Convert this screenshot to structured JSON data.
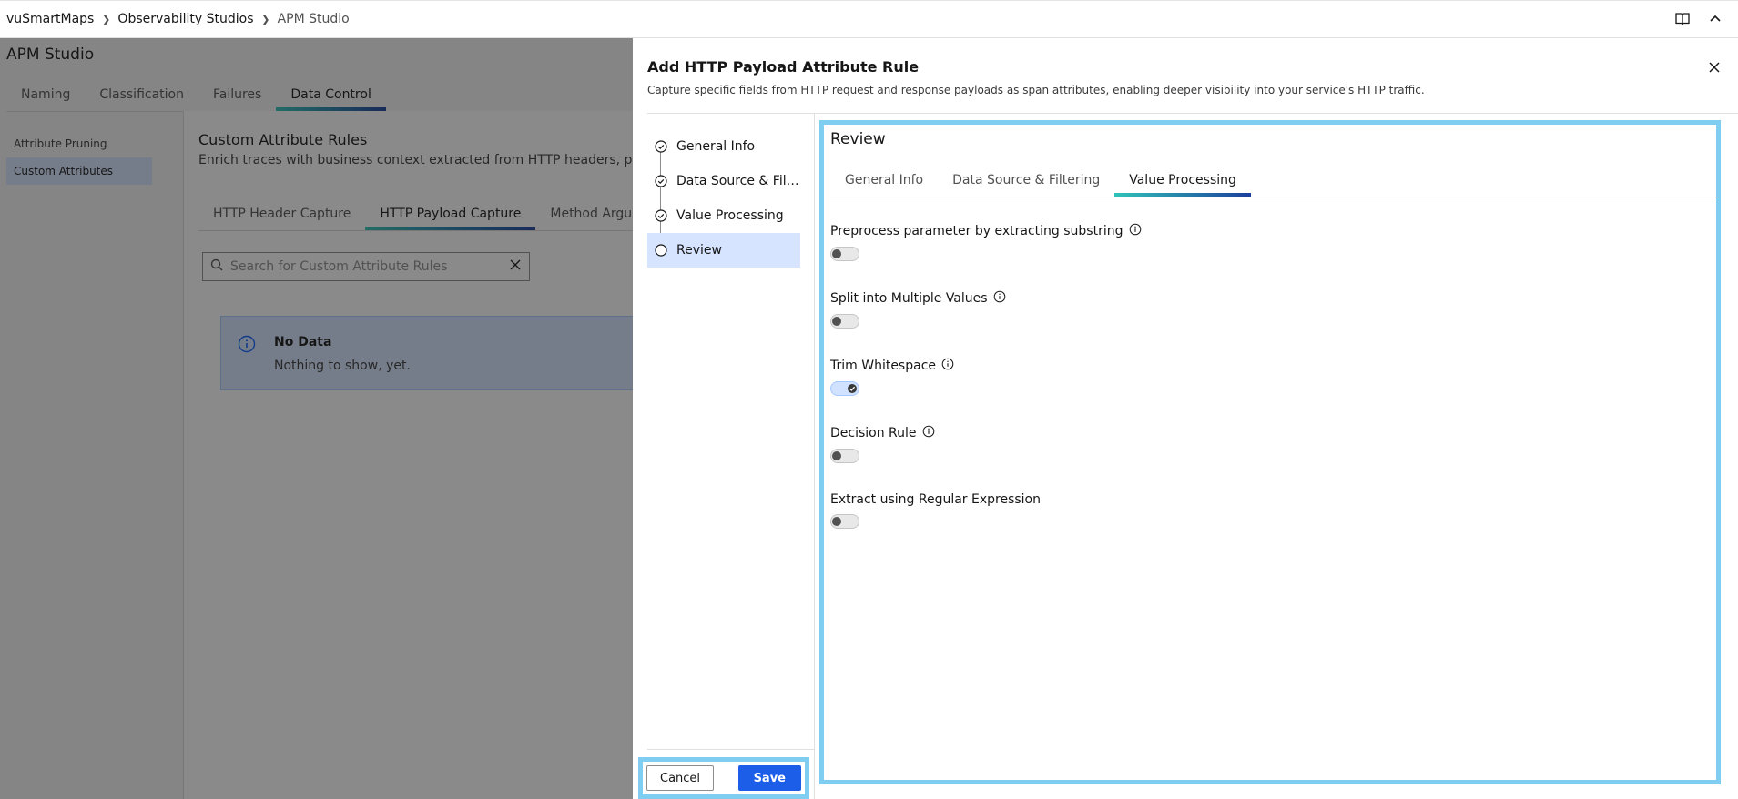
{
  "breadcrumbs": [
    "vuSmartMaps",
    "Observability Studios",
    "APM Studio"
  ],
  "background": {
    "title": "APM Studio",
    "tabs": [
      "Naming",
      "Classification",
      "Failures",
      "Data Control"
    ],
    "active_tab": "Data Control",
    "side_items": [
      "Attribute Pruning",
      "Custom Attributes"
    ],
    "active_side_item": "Custom Attributes",
    "panel_title": "Custom Attribute Rules",
    "panel_desc": "Enrich traces with business context extracted from HTTP headers, payload",
    "subtabs": [
      "HTTP Header Capture",
      "HTTP Payload Capture",
      "Method Argumen"
    ],
    "active_subtab": "HTTP Payload Capture",
    "search_placeholder": "Search for Custom Attribute Rules",
    "no_data_title": "No Data",
    "no_data_sub": "Nothing to show, yet."
  },
  "modal": {
    "title": "Add HTTP Payload Attribute Rule",
    "description": "Capture specific fields from HTTP request and response payloads as span attributes, enabling deeper visibility into your service's HTTP traffic.",
    "steps": [
      "General Info",
      "Data Source & Filt...",
      "Value Processing",
      "Review"
    ],
    "active_step": "Review",
    "review": {
      "title": "Review",
      "tabs": [
        "General Info",
        "Data Source & Filtering",
        "Value Processing"
      ],
      "active_tab": "Value Processing",
      "fields": [
        {
          "label": "Preprocess parameter by extracting substring",
          "info": true,
          "enabled": false
        },
        {
          "label": "Split into Multiple Values",
          "info": true,
          "enabled": false
        },
        {
          "label": "Trim Whitespace",
          "info": true,
          "enabled": true
        },
        {
          "label": "Decision Rule",
          "info": true,
          "enabled": false
        },
        {
          "label": "Extract using Regular Expression",
          "info": false,
          "enabled": false
        }
      ]
    },
    "cancel_label": "Cancel",
    "save_label": "Save"
  },
  "colors": {
    "accent": "#1d5ee8",
    "highlight": "#7fcdf0",
    "tab_gradient_start": "#2fc2b8",
    "tab_gradient_end": "#1c3f9c"
  },
  "icons": [
    "book-icon",
    "chevron-up-icon",
    "close-icon",
    "search-icon",
    "info-icon",
    "check-circle-icon",
    "circle-icon"
  ]
}
